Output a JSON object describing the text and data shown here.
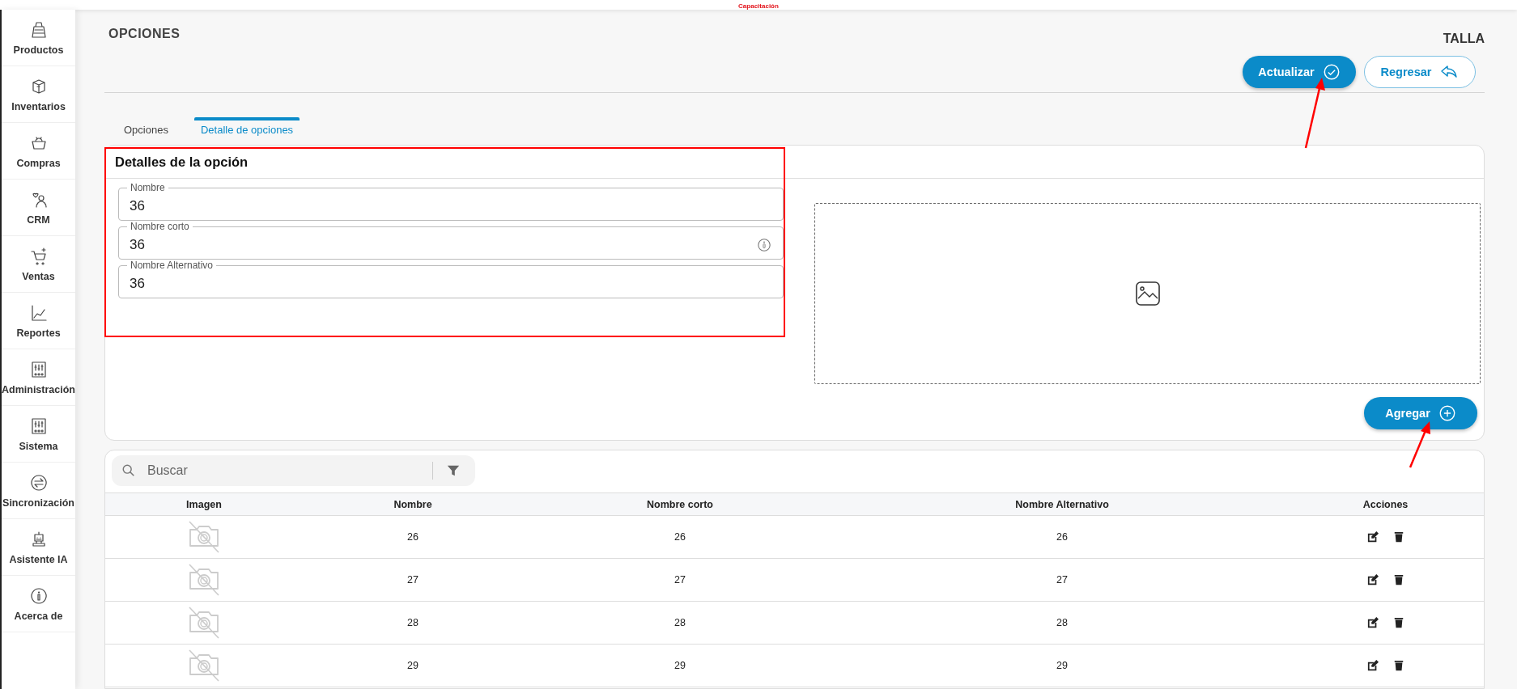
{
  "app_banner": "Capacitación",
  "sidebar": {
    "items": [
      {
        "label": "Productos"
      },
      {
        "label": "Inventarios"
      },
      {
        "label": "Compras"
      },
      {
        "label": "CRM"
      },
      {
        "label": "Ventas"
      },
      {
        "label": "Reportes"
      },
      {
        "label": "Administración"
      },
      {
        "label": "Sistema"
      },
      {
        "label": "Sincronización"
      },
      {
        "label": "Asistente IA"
      },
      {
        "label": "Acerca de"
      }
    ]
  },
  "page": {
    "title": "OPCIONES",
    "entity": "TALLA"
  },
  "actions": [
    {
      "label": "Actualizar",
      "kind": "primary"
    },
    {
      "label": "Regresar",
      "kind": "secondary"
    }
  ],
  "tabs": [
    {
      "label": "Opciones",
      "selected": false
    },
    {
      "label": "Detalle de opciones",
      "selected": true
    }
  ],
  "details": {
    "title": "Detalles de la opción",
    "fields": [
      {
        "label": "Nombre",
        "value": "36",
        "info": false
      },
      {
        "label": "Nombre corto",
        "value": "36",
        "info": true
      },
      {
        "label": "Nombre Alternativo",
        "value": "36",
        "info": false
      }
    ]
  },
  "add_button": {
    "label": "Agregar"
  },
  "search": {
    "placeholder": "Buscar"
  },
  "table": {
    "columns": [
      "Imagen",
      "Nombre",
      "Nombre corto",
      "Nombre Alternativo",
      "Acciones"
    ],
    "rows": [
      {
        "nombre": "26",
        "nombre_corto": "26",
        "nombre_alternativo": "26"
      },
      {
        "nombre": "27",
        "nombre_corto": "27",
        "nombre_alternativo": "27"
      },
      {
        "nombre": "28",
        "nombre_corto": "28",
        "nombre_alternativo": "28"
      },
      {
        "nombre": "29",
        "nombre_corto": "29",
        "nombre_alternativo": "29"
      }
    ]
  }
}
